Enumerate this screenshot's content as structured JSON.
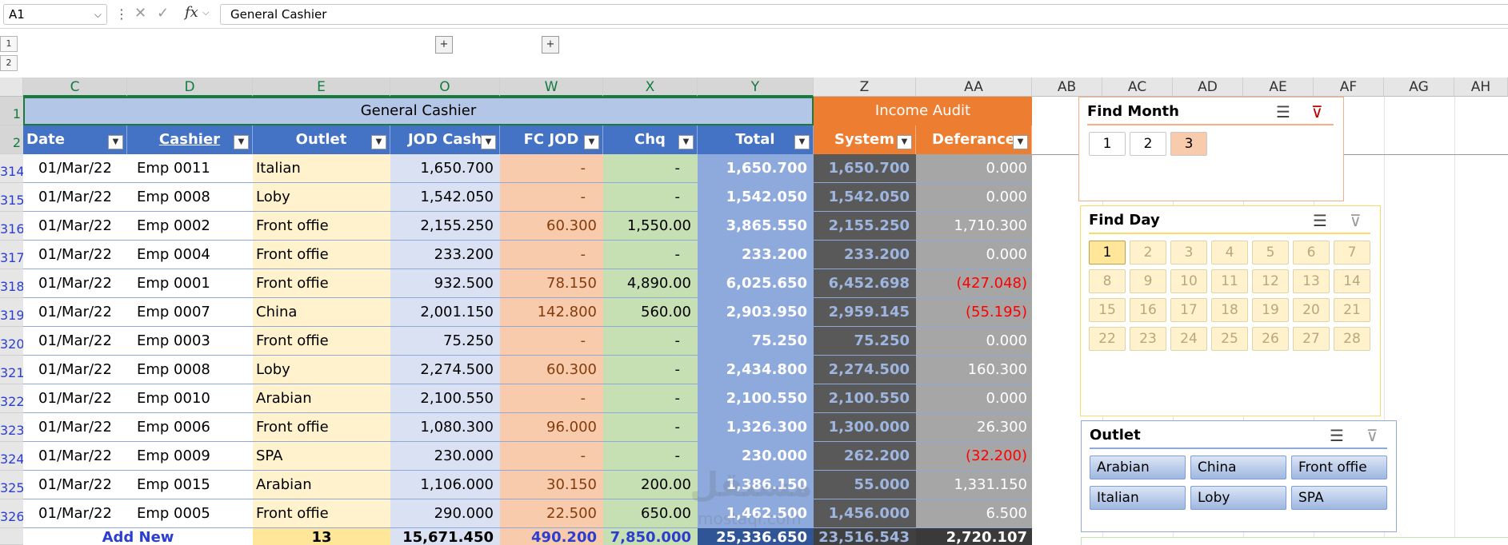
{
  "formula_bar": {
    "name_box": "A1",
    "formula": "General Cashier",
    "fx": "fx"
  },
  "outline": {
    "levels": [
      "1",
      "2"
    ],
    "expand": "+"
  },
  "columns": [
    "C",
    "D",
    "E",
    "O",
    "W",
    "X",
    "Y",
    "Z",
    "AA",
    "AB",
    "AC",
    "AD",
    "AE",
    "AF",
    "AG",
    "AH"
  ],
  "bands": {
    "general_cashier": "General Cashier",
    "income_audit": "Income Audit"
  },
  "headers": {
    "date": "Date",
    "cashier": "Cashier",
    "outlet": "Outlet",
    "jod_cash": "JOD Cash",
    "fc_jod": "FC JOD",
    "chq": "Chq",
    "total": "Total",
    "system": "System",
    "deferance": "Deferance"
  },
  "row_numbers": [
    "1",
    "2",
    "314",
    "315",
    "316",
    "317",
    "318",
    "319",
    "320",
    "321",
    "322",
    "323",
    "324",
    "325",
    "326"
  ],
  "rows": [
    {
      "date": "01/Mar/22",
      "cashier": "Emp 0011",
      "outlet": "Italian",
      "jod": "1,650.700",
      "fc": "-",
      "chq": "-",
      "total": "1,650.700",
      "system": "1,650.700",
      "def": "0.000"
    },
    {
      "date": "01/Mar/22",
      "cashier": "Emp 0008",
      "outlet": "Loby",
      "jod": "1,542.050",
      "fc": "-",
      "chq": "-",
      "total": "1,542.050",
      "system": "1,542.050",
      "def": "0.000"
    },
    {
      "date": "01/Mar/22",
      "cashier": "Emp 0002",
      "outlet": "Front offie",
      "jod": "2,155.250",
      "fc": "60.300",
      "chq": "1,550.00",
      "total": "3,865.550",
      "system": "2,155.250",
      "def": "1,710.300"
    },
    {
      "date": "01/Mar/22",
      "cashier": "Emp 0004",
      "outlet": "Front offie",
      "jod": "233.200",
      "fc": "-",
      "chq": "-",
      "total": "233.200",
      "system": "233.200",
      "def": "0.000"
    },
    {
      "date": "01/Mar/22",
      "cashier": "Emp 0001",
      "outlet": "Front offie",
      "jod": "932.500",
      "fc": "78.150",
      "chq": "4,890.00",
      "total": "6,025.650",
      "system": "6,452.698",
      "def": "(427.048)"
    },
    {
      "date": "01/Mar/22",
      "cashier": "Emp 0007",
      "outlet": "China",
      "jod": "2,001.150",
      "fc": "142.800",
      "chq": "560.00",
      "total": "2,903.950",
      "system": "2,959.145",
      "def": "(55.195)"
    },
    {
      "date": "01/Mar/22",
      "cashier": "Emp 0003",
      "outlet": "Front offie",
      "jod": "75.250",
      "fc": "-",
      "chq": "-",
      "total": "75.250",
      "system": "75.250",
      "def": "0.000"
    },
    {
      "date": "01/Mar/22",
      "cashier": "Emp 0008",
      "outlet": "Loby",
      "jod": "2,274.500",
      "fc": "60.300",
      "chq": "-",
      "total": "2,434.800",
      "system": "2,274.500",
      "def": "160.300"
    },
    {
      "date": "01/Mar/22",
      "cashier": "Emp 0010",
      "outlet": "Arabian",
      "jod": "2,100.550",
      "fc": "-",
      "chq": "-",
      "total": "2,100.550",
      "system": "2,100.550",
      "def": "0.000"
    },
    {
      "date": "01/Mar/22",
      "cashier": "Emp 0006",
      "outlet": "Front offie",
      "jod": "1,080.300",
      "fc": "96.000",
      "chq": "-",
      "total": "1,326.300",
      "system": "1,300.000",
      "def": "26.300"
    },
    {
      "date": "01/Mar/22",
      "cashier": "Emp 0009",
      "outlet": "SPA",
      "jod": "230.000",
      "fc": "-",
      "chq": "-",
      "total": "230.000",
      "system": "262.200",
      "def": "(32.200)"
    },
    {
      "date": "01/Mar/22",
      "cashier": "Emp 0015",
      "outlet": "Arabian",
      "jod": "1,106.000",
      "fc": "30.150",
      "chq": "200.00",
      "total": "1,386.150",
      "system": "55.000",
      "def": "1,331.150"
    },
    {
      "date": "01/Mar/22",
      "cashier": "Emp 0005",
      "outlet": "Front offie",
      "jod": "290.000",
      "fc": "22.500",
      "chq": "650.00",
      "total": "1,462.500",
      "system": "1,456.000",
      "def": "6.500"
    }
  ],
  "summary": {
    "add_new": "Add New",
    "count": "13",
    "jod": "15,671.450",
    "fc": "490.200",
    "chq": "7,850.000",
    "total": "25,336.650",
    "system": "23,516.543",
    "def": "2,720.107"
  },
  "slicers": {
    "month": {
      "title": "Find Month",
      "items": [
        "1",
        "2",
        "3"
      ],
      "selected": "3"
    },
    "day": {
      "title": "Find Day",
      "items": [
        "1",
        "2",
        "3",
        "4",
        "5",
        "6",
        "7",
        "8",
        "9",
        "10",
        "11",
        "12",
        "13",
        "14",
        "15",
        "16",
        "17",
        "18",
        "19",
        "20",
        "21",
        "22",
        "23",
        "24",
        "25",
        "26",
        "27",
        "28"
      ],
      "selected": "1"
    },
    "outlet": {
      "title": "Outlet",
      "items": [
        "Arabian",
        "China",
        "Front offie",
        "Italian",
        "Loby",
        "SPA"
      ]
    }
  },
  "watermark": {
    "logo": "مستقل",
    "site": "mostaql.com"
  },
  "colors": {
    "header_blue": "#4472c4",
    "audit_orange": "#ed7d31",
    "band_blue": "#b4c6e7",
    "negative_red": "#ff0000"
  }
}
